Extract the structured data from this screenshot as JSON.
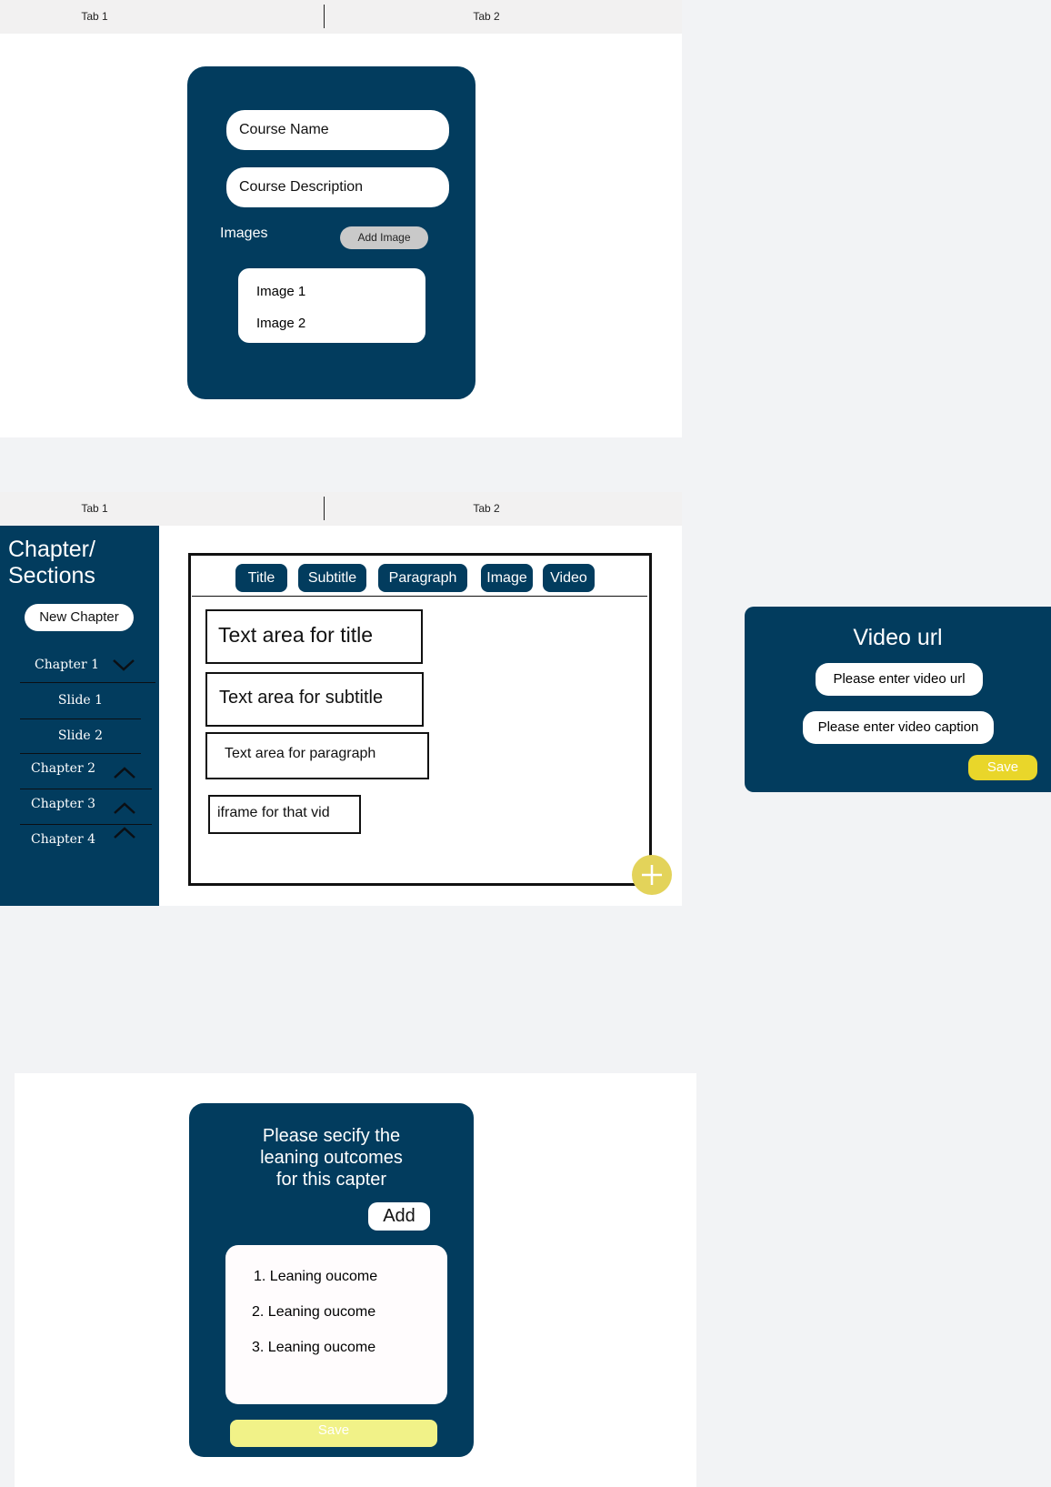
{
  "screen1": {
    "tabs": [
      "Tab 1",
      "Tab 2"
    ],
    "course_name_placeholder": "Course Name",
    "course_description_placeholder": "Course Description",
    "images_label": "Images",
    "add_image_label": "Add Image",
    "images": [
      "Image 1",
      "Image 2"
    ]
  },
  "screen2": {
    "tabs": [
      "Tab 1",
      "Tab 2"
    ],
    "sidebar": {
      "title_line1": "Chapter/",
      "title_line2": "Sections",
      "new_chapter_label": "New Chapter",
      "items": [
        {
          "label": "Chapter 1",
          "chevron": "chevron-down-icon"
        },
        {
          "label": "Slide 1"
        },
        {
          "label": "Slide 2"
        },
        {
          "label": "Chapter 2",
          "chevron": "chevron-up-icon"
        },
        {
          "label": "Chapter 3",
          "chevron": "chevron-up-icon"
        },
        {
          "label": "Chapter 4",
          "chevron": "chevron-up-icon"
        }
      ]
    },
    "toolbar": [
      "Title",
      "Subtitle",
      "Paragraph",
      "Image",
      "Video"
    ],
    "text_title": "Text area for title",
    "text_subtitle": "Text area for subtitle",
    "text_paragraph": "Text area for paragraph",
    "iframe_label": "iframe for that vid",
    "add_icon": "plus-icon"
  },
  "video_modal": {
    "title": "Video url",
    "url_placeholder": "Please enter video url",
    "caption_placeholder": "Please enter video caption",
    "save_label": "Save"
  },
  "outcomes": {
    "prompt_line1": "Please secify the",
    "prompt_line2": "leaning outcomes",
    "prompt_line3": "for this capter",
    "add_label": "Add",
    "items": [
      "1. Leaning oucome",
      "2. Leaning oucome",
      "3. Leaning oucome"
    ],
    "save_label": "Save"
  },
  "colors": {
    "navy": "#023c5e",
    "yellow": "#e9d62a",
    "light_yellow": "#f1f288",
    "plus_yellow": "#e3d35a",
    "gray_button": "#c9c9c9"
  }
}
